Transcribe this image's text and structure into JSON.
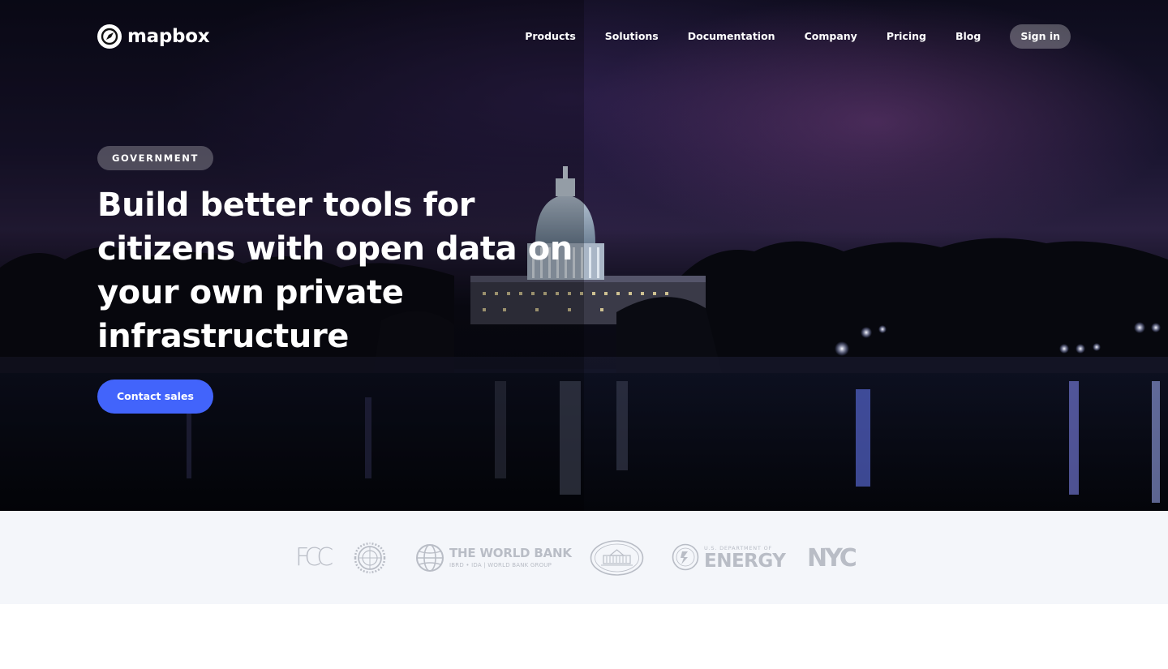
{
  "brand": {
    "name": "mapbox",
    "icon": "mapbox-logo-icon"
  },
  "nav": {
    "links": [
      "Products",
      "Solutions",
      "Documentation",
      "Company",
      "Pricing",
      "Blog"
    ],
    "signin_label": "Sign in"
  },
  "hero": {
    "badge": "GOVERNMENT",
    "headline": "Build better tools for citizens with open data on your own private infrastructure",
    "cta_label": "Contact sales"
  },
  "clients": {
    "fcc": "FCC",
    "un": "un-emblem-icon",
    "world_bank": {
      "title": "THE WORLD BANK",
      "subtitle": "IBRD • IDA | WORLD BANK GROUP"
    },
    "white_house": "white-house-seal-icon",
    "energy": {
      "small": "U.S. DEPARTMENT OF",
      "big": "ENERGY"
    },
    "nyc": "NYC"
  },
  "colors": {
    "accent": "#4264fb",
    "logo_gray": "#b9bdc6",
    "strip_bg": "#f4f6fa"
  }
}
